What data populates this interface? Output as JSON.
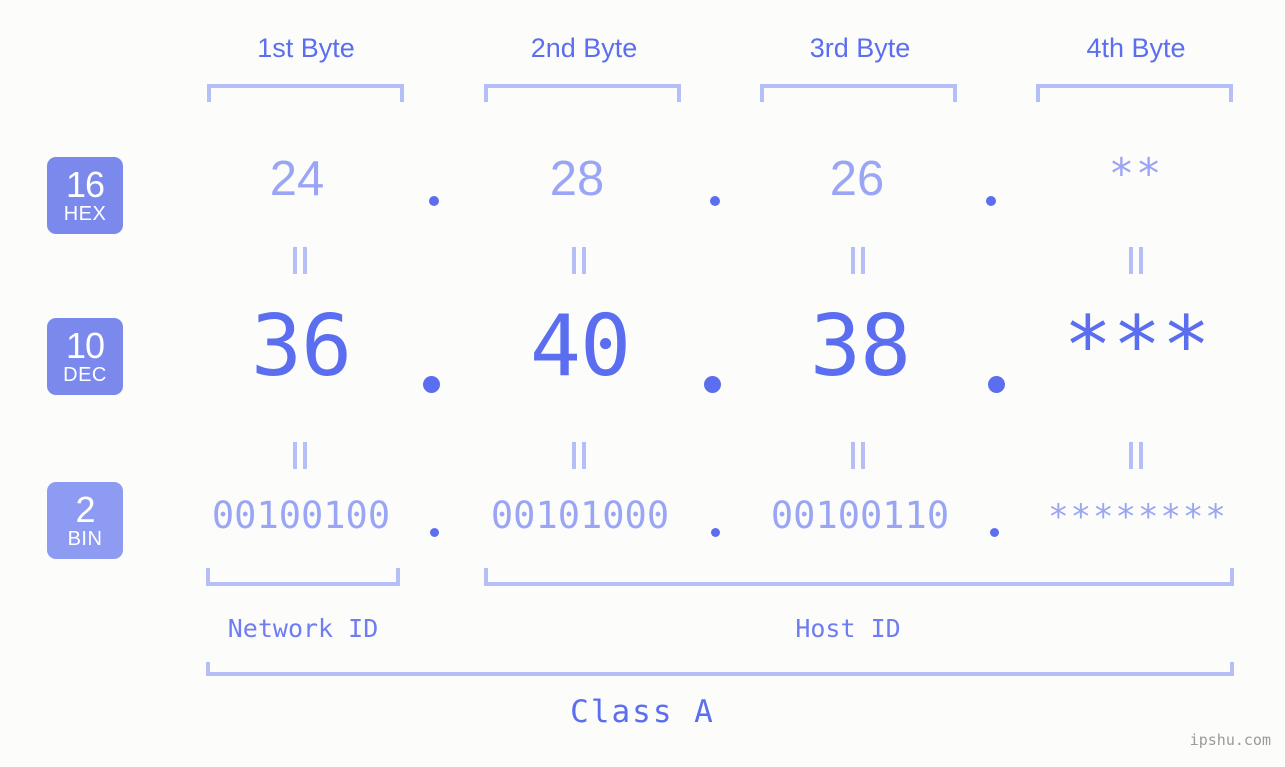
{
  "meta": {
    "background_color": "#fcfdfa",
    "accent_color": "#5b6ef0",
    "light_accent_color": "#9aa6f5",
    "bracket_color": "#b6bef8",
    "badge_color": "#7b88ec",
    "badge_color_bin": "#8e9bf3",
    "watermark": "ipshu.com"
  },
  "headers": [
    {
      "label": "1st Byte"
    },
    {
      "label": "2nd Byte"
    },
    {
      "label": "3rd Byte"
    },
    {
      "label": "4th Byte"
    }
  ],
  "bases": [
    {
      "number": "16",
      "name": "HEX"
    },
    {
      "number": "10",
      "name": "DEC"
    },
    {
      "number": "2",
      "name": "BIN"
    }
  ],
  "rows": {
    "hex": {
      "base": "16",
      "name": "HEX",
      "values": [
        "24",
        "28",
        "26",
        "**"
      ]
    },
    "dec": {
      "base": "10",
      "name": "DEC",
      "values": [
        "36",
        "40",
        "38",
        "***"
      ]
    },
    "bin": {
      "base": "2",
      "name": "BIN",
      "values": [
        "00100100",
        "00101000",
        "00100110",
        "********"
      ]
    }
  },
  "separator": ".",
  "equivalence_symbol": "=",
  "segments": [
    {
      "label": "Network ID"
    },
    {
      "label": "Host ID"
    }
  ],
  "class": {
    "label": "Class A"
  }
}
